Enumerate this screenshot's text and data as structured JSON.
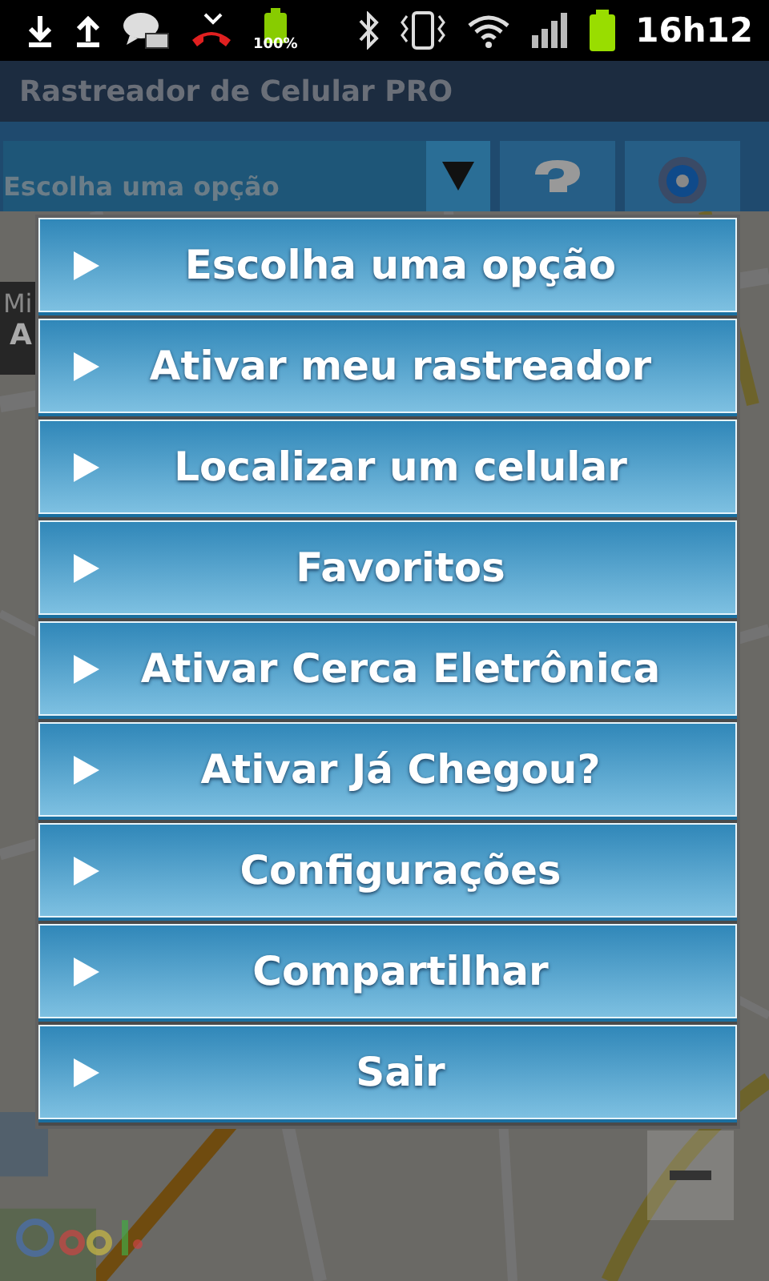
{
  "status_bar": {
    "battery_percent": "100%",
    "time": "16h12"
  },
  "title_bar": {
    "title": "Rastreador de Celular PRO"
  },
  "toolbar": {
    "spinner": {
      "value": "Escolha uma opção"
    }
  },
  "info_panel": {
    "line_1": "Mi",
    "line_2": "A"
  },
  "menu": {
    "items": [
      {
        "label": "Escolha uma opção"
      },
      {
        "label": "Ativar meu rastreador"
      },
      {
        "label": "Localizar um celular"
      },
      {
        "label": "Favoritos"
      },
      {
        "label": "Ativar Cerca Eletrônica"
      },
      {
        "label": "Ativar Já Chegou?"
      },
      {
        "label": "Configurações"
      },
      {
        "label": "Compartilhar"
      },
      {
        "label": "Sair"
      }
    ]
  }
}
